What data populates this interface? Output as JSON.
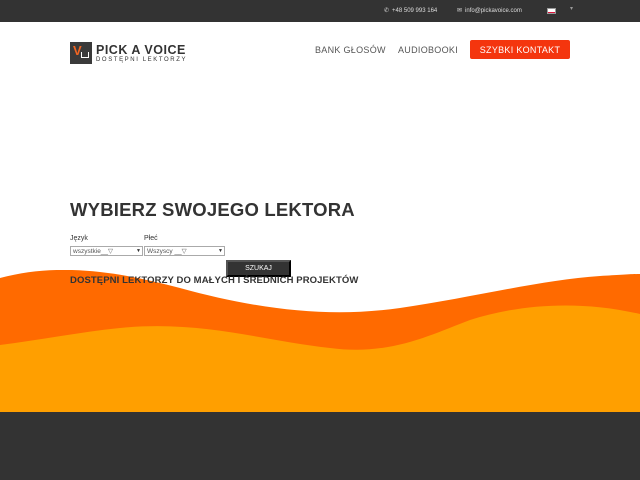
{
  "topbar": {
    "phone": "+48 509 993 164",
    "email": "info@pickavoice.com",
    "phone_icon": "phone-icon",
    "email_icon": "envelope-icon",
    "language_flag": "flag-pl-icon"
  },
  "header": {
    "logo": {
      "title": "PICK A VOICE",
      "tagline": "DOSTĘPNI LEKTORZY"
    },
    "nav": {
      "bank": "BANK GŁOSÓW",
      "audiobooki": "AUDIOBOOKI",
      "cta": "SZYBKI KONTAKT"
    }
  },
  "hero": {
    "title": "WYBIERZ SWOJEGO LEKTORA",
    "subtitle": "DOSTĘPNI LEKTORZY DO MAŁYCH I ŚREDNICH PROJEKTÓW",
    "filters": {
      "language_label": "Język",
      "language_value": "wszystkie__▽",
      "gender_label": "Płeć",
      "gender_value": "Wszyscy __▽"
    },
    "search_label": "SZUKAJ"
  },
  "colors": {
    "accent": "#f4350e",
    "wave_dark": "#ff6a00",
    "wave_light": "#ff9f00",
    "dark": "#333333"
  }
}
